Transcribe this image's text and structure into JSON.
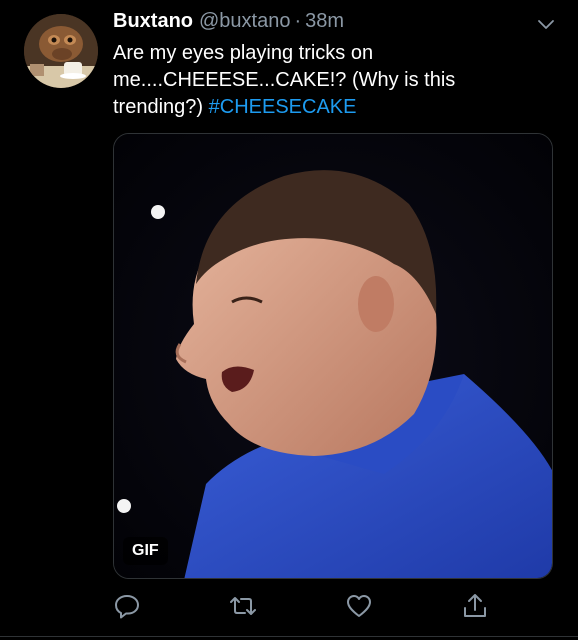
{
  "tweet": {
    "display_name": "Buxtano",
    "handle": "@buxtano",
    "separator": "·",
    "time": "38m",
    "text_line": "Are my eyes playing tricks on me....CHEEESE...CAKE!? (Why is this trending?)",
    "hashtag": "#CHEESECAKE",
    "media_badge": "GIF"
  },
  "icons": {
    "caret": "chevron-down-icon",
    "reply": "reply-icon",
    "retweet": "retweet-icon",
    "like": "heart-icon",
    "share": "share-icon"
  },
  "colors": {
    "background": "#000000",
    "text": "#ffffff",
    "secondary": "#8b98a5",
    "link": "#1d9bf0"
  }
}
